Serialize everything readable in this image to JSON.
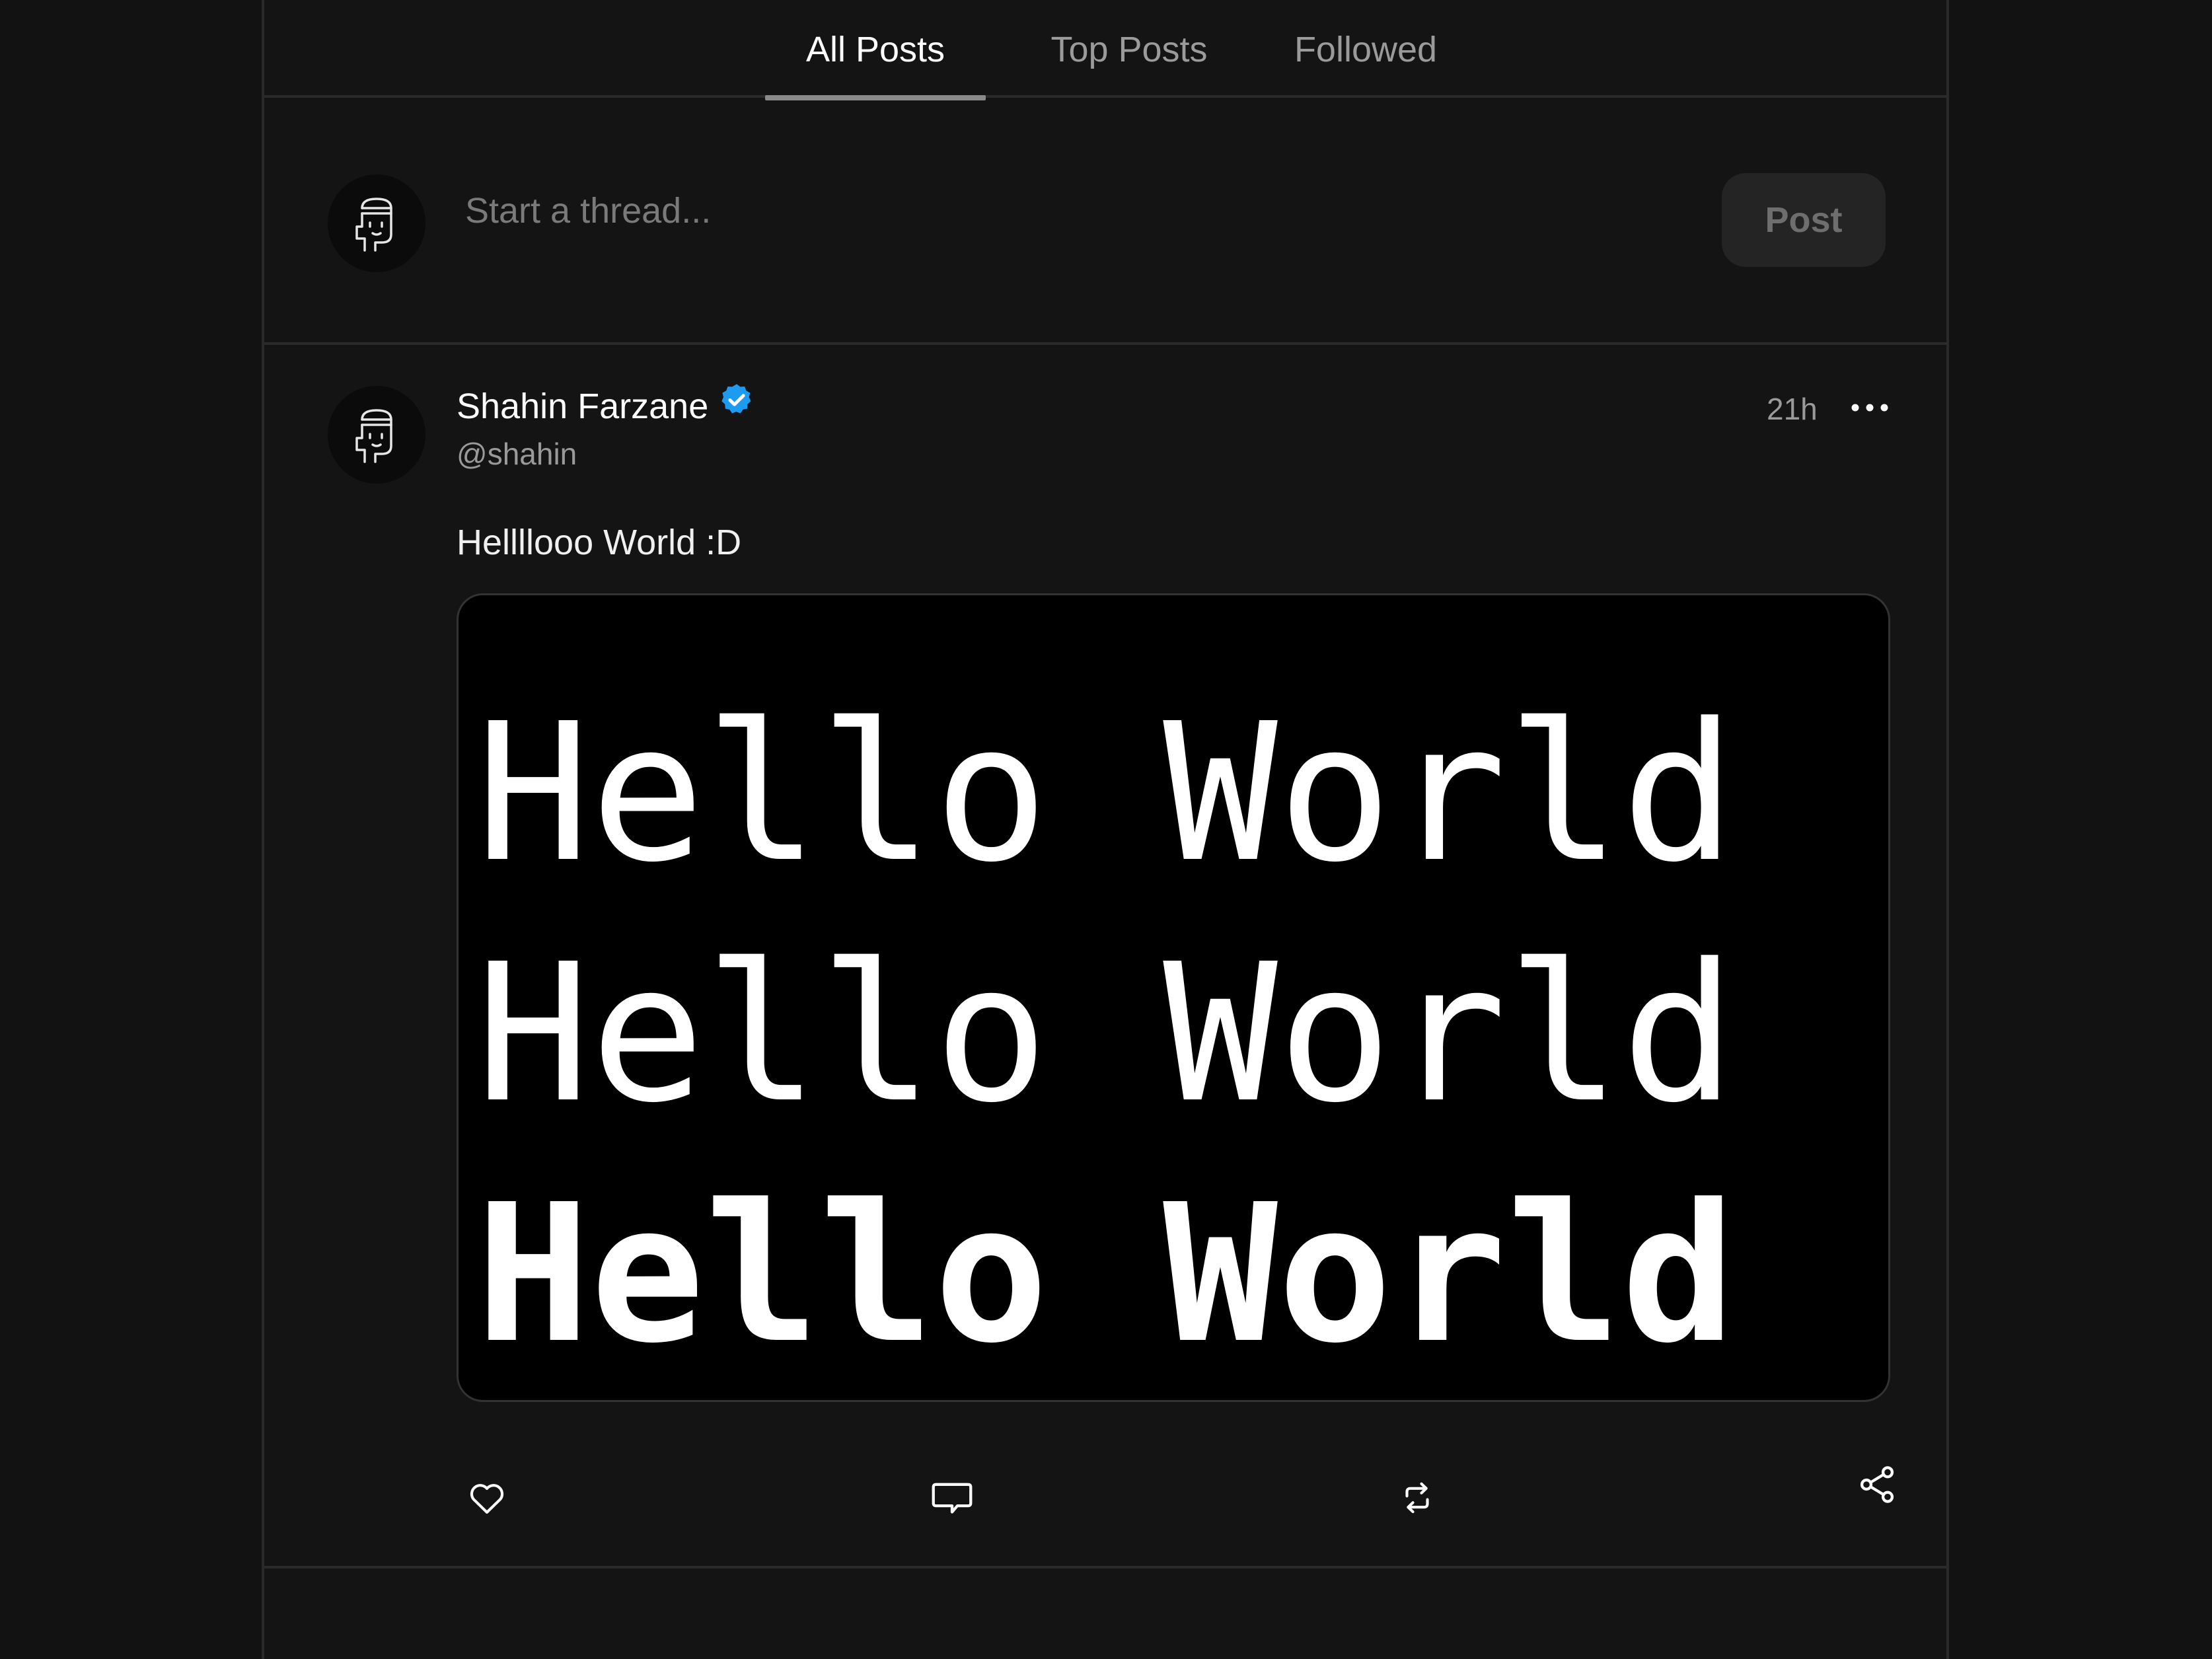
{
  "tabs": [
    {
      "label": "All Posts",
      "active": true
    },
    {
      "label": "Top Posts",
      "active": false
    },
    {
      "label": "Followed",
      "active": false
    }
  ],
  "composer": {
    "placeholder": "Start a thread...",
    "post_label": "Post"
  },
  "post": {
    "author_name": "Shahin Farzane",
    "handle": "@shahin",
    "verified": true,
    "timestamp": "21h",
    "text": "Hellllooo World :D",
    "media_lines": [
      "Hello World",
      "Hello World",
      "Hello World"
    ],
    "actions": [
      "heart-icon",
      "comment-icon",
      "repost-icon",
      "share-icon"
    ]
  },
  "colors": {
    "background": "#121212",
    "panel": "#141414",
    "border": "#2a2a2a",
    "verified": "#1d9bf0",
    "text_primary": "#ffffff",
    "text_secondary": "#9a9a9a"
  }
}
